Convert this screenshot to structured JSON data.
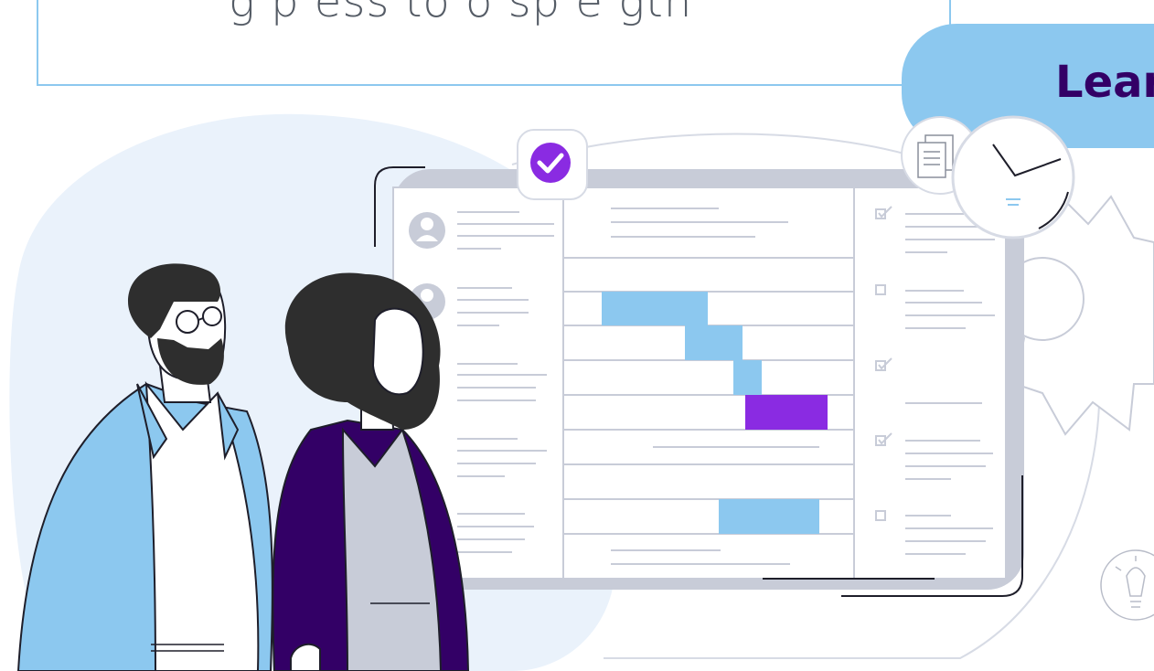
{
  "header": {
    "subtitle": "g p ess to o sp e gth",
    "cta_label": "Lear"
  },
  "colors": {
    "accent_blue": "#8cc8ef",
    "accent_purple": "#8a2be2",
    "dark_purple": "#330066",
    "panel_gray": "#c8ccd8",
    "blob": "#eaf2fb"
  },
  "icons": [
    "checkmark-badge-icon",
    "user-avatar-icon",
    "document-icon",
    "clock-icon",
    "gear-icon",
    "lightbulb-icon",
    "checkbox-icon"
  ]
}
